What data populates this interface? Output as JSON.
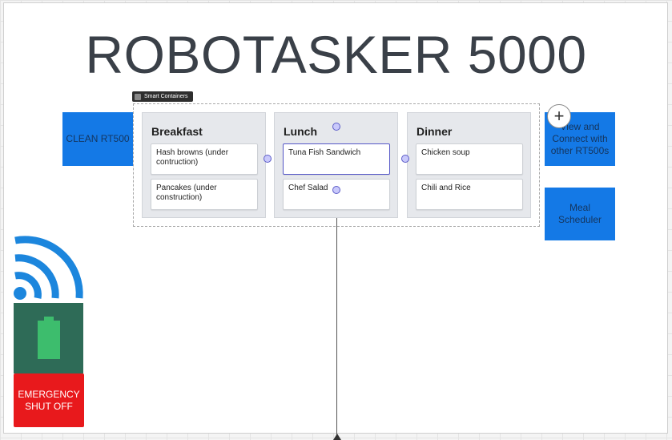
{
  "title": "ROBOTASKER 5000",
  "buttons": {
    "clean": "CLEAN RT500",
    "view_connect": "View and Connect with other RT500s",
    "meal_scheduler": "Meal Scheduler",
    "emergency": "EMERGENCY SHUT OFF"
  },
  "smart_containers": {
    "label": "Smart Containers",
    "columns": [
      {
        "title": "Breakfast",
        "cards": [
          "Hash browns (under contruction)",
          "Pancakes (under construction)"
        ]
      },
      {
        "title": "Lunch",
        "cards": [
          "Tuna Fish Sandwich",
          "Chef Salad"
        ]
      },
      {
        "title": "Dinner",
        "cards": [
          "Chicken soup",
          "Chili and Rice"
        ]
      }
    ]
  },
  "colors": {
    "button_blue": "#1479e6",
    "emergency_red": "#e8191c",
    "battery_panel": "#2e6b57",
    "battery_fill": "#3dbd6d",
    "wifi_blue": "#1c86dd"
  },
  "icons": {
    "wifi": "wifi-icon",
    "battery": "battery-icon",
    "add": "plus-icon"
  }
}
